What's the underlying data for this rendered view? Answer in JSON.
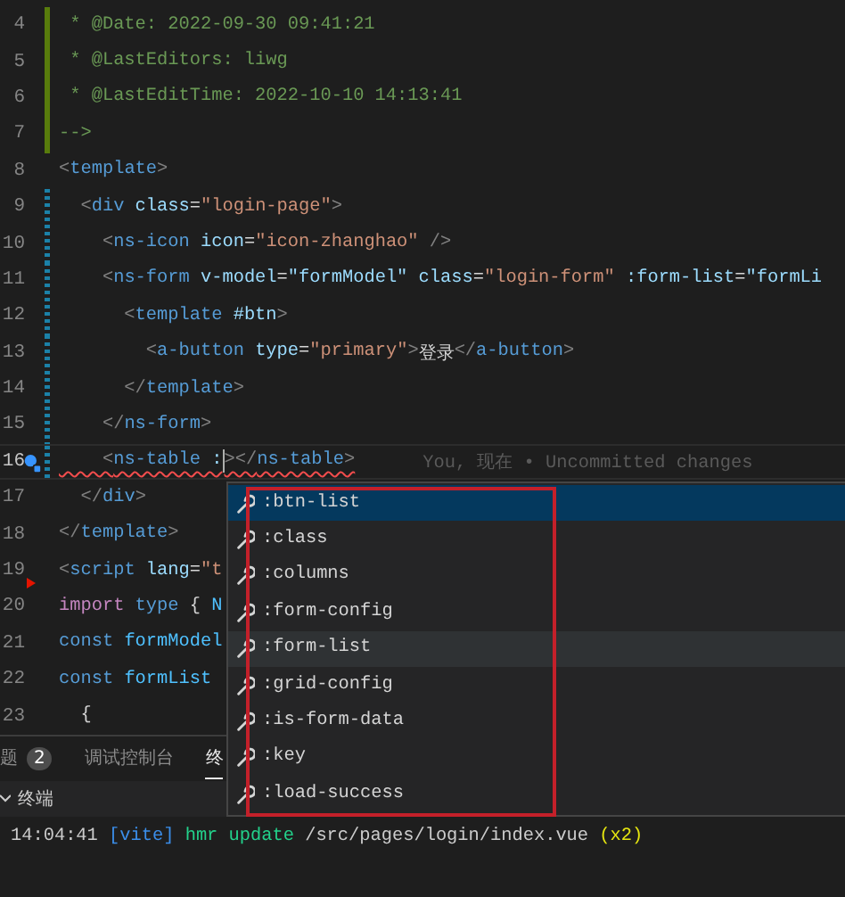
{
  "editor": {
    "lines": [
      {
        "number": "4",
        "added": true,
        "modified": false,
        "current": false,
        "tokens": [
          {
            "kind": "comment",
            "text": " * @Date: 2022-09-30 09:41:21"
          }
        ]
      },
      {
        "number": "5",
        "added": true,
        "modified": false,
        "current": false,
        "tokens": [
          {
            "kind": "comment",
            "text": " * @LastEditors: liwg"
          }
        ]
      },
      {
        "number": "6",
        "added": true,
        "modified": false,
        "current": false,
        "tokens": [
          {
            "kind": "comment",
            "text": " * @LastEditTime: 2022-10-10 14:13:41"
          }
        ]
      },
      {
        "number": "7",
        "added": true,
        "modified": false,
        "current": false,
        "tokens": [
          {
            "kind": "comment",
            "text": "-->"
          }
        ]
      },
      {
        "number": "8",
        "added": false,
        "modified": false,
        "current": false,
        "tokens": [
          {
            "kind": "punct",
            "text": "<"
          },
          {
            "kind": "tag",
            "text": "template"
          },
          {
            "kind": "punct",
            "text": ">"
          }
        ]
      },
      {
        "number": "9",
        "added": false,
        "modified": true,
        "current": false,
        "tokens": [
          {
            "kind": "punct",
            "text": "  <"
          },
          {
            "kind": "tag",
            "text": "div"
          },
          {
            "kind": "attr",
            "text": " class"
          },
          {
            "kind": "text",
            "text": "="
          },
          {
            "kind": "string",
            "text": "\"login-page\""
          },
          {
            "kind": "punct",
            "text": ">"
          }
        ]
      },
      {
        "number": "10",
        "added": false,
        "modified": true,
        "current": false,
        "tokens": [
          {
            "kind": "punct",
            "text": "    <"
          },
          {
            "kind": "tag",
            "text": "ns-icon"
          },
          {
            "kind": "attr",
            "text": " icon"
          },
          {
            "kind": "text",
            "text": "="
          },
          {
            "kind": "string",
            "text": "\"icon-zhanghao\""
          },
          {
            "kind": "punct",
            "text": " />"
          }
        ]
      },
      {
        "number": "11",
        "added": false,
        "modified": true,
        "current": false,
        "tokens": [
          {
            "kind": "punct",
            "text": "    <"
          },
          {
            "kind": "tag",
            "text": "ns-form"
          },
          {
            "kind": "attr",
            "text": " v-model"
          },
          {
            "kind": "text",
            "text": "="
          },
          {
            "kind": "attr",
            "text": "\"formModel\""
          },
          {
            "kind": "attr",
            "text": " class"
          },
          {
            "kind": "text",
            "text": "="
          },
          {
            "kind": "string",
            "text": "\"login-form\""
          },
          {
            "kind": "attr",
            "text": " :form-list"
          },
          {
            "kind": "text",
            "text": "="
          },
          {
            "kind": "attr",
            "text": "\"formLi"
          }
        ]
      },
      {
        "number": "12",
        "added": false,
        "modified": true,
        "current": false,
        "tokens": [
          {
            "kind": "punct",
            "text": "      <"
          },
          {
            "kind": "tag",
            "text": "template"
          },
          {
            "kind": "attr",
            "text": " #btn"
          },
          {
            "kind": "punct",
            "text": ">"
          }
        ]
      },
      {
        "number": "13",
        "added": false,
        "modified": true,
        "current": false,
        "tokens": [
          {
            "kind": "punct",
            "text": "        <"
          },
          {
            "kind": "tag",
            "text": "a-button"
          },
          {
            "kind": "attr",
            "text": " type"
          },
          {
            "kind": "text",
            "text": "="
          },
          {
            "kind": "string",
            "text": "\"primary\""
          },
          {
            "kind": "punct",
            "text": ">"
          },
          {
            "kind": "text",
            "text": "登录"
          },
          {
            "kind": "punct",
            "text": "</"
          },
          {
            "kind": "tag",
            "text": "a-button"
          },
          {
            "kind": "punct",
            "text": ">"
          }
        ]
      },
      {
        "number": "14",
        "added": false,
        "modified": true,
        "current": false,
        "tokens": [
          {
            "kind": "punct",
            "text": "      </"
          },
          {
            "kind": "tag",
            "text": "template"
          },
          {
            "kind": "punct",
            "text": ">"
          }
        ]
      },
      {
        "number": "15",
        "added": false,
        "modified": true,
        "current": false,
        "tokens": [
          {
            "kind": "punct",
            "text": "    </"
          },
          {
            "kind": "tag",
            "text": "ns-form"
          },
          {
            "kind": "punct",
            "text": ">"
          }
        ]
      },
      {
        "number": "16",
        "added": false,
        "modified": true,
        "current": true,
        "error": true,
        "lightbulb": true,
        "blame": "You, 现在 • Uncommitted changes",
        "tokens": [
          {
            "kind": "punct",
            "text": "    <"
          },
          {
            "kind": "tag",
            "text": "ns-table"
          },
          {
            "kind": "attr",
            "text": " :",
            "cursor_after": true
          },
          {
            "kind": "punct",
            "text": "></"
          },
          {
            "kind": "tag",
            "text": "ns-table"
          },
          {
            "kind": "punct",
            "text": ">"
          }
        ]
      },
      {
        "number": "17",
        "added": false,
        "modified": false,
        "current": false,
        "tokens": [
          {
            "kind": "punct",
            "text": "  </"
          },
          {
            "kind": "tag",
            "text": "div"
          },
          {
            "kind": "punct",
            "text": ">"
          }
        ]
      },
      {
        "number": "18",
        "added": false,
        "modified": false,
        "current": false,
        "tokens": [
          {
            "kind": "punct",
            "text": "</"
          },
          {
            "kind": "tag",
            "text": "template"
          },
          {
            "kind": "punct",
            "text": ">"
          }
        ]
      },
      {
        "number": "19",
        "added": false,
        "modified": false,
        "current": false,
        "tokens": [
          {
            "kind": "punct",
            "text": "<"
          },
          {
            "kind": "tag",
            "text": "script"
          },
          {
            "kind": "attr",
            "text": " lang"
          },
          {
            "kind": "text",
            "text": "="
          },
          {
            "kind": "string",
            "text": "\"t"
          }
        ]
      },
      {
        "number": "20",
        "added": false,
        "modified": false,
        "current": false,
        "fold_marker": true,
        "tokens": [
          {
            "kind": "keyword",
            "text": "import"
          },
          {
            "kind": "tag",
            "text": " type"
          },
          {
            "kind": "text",
            "text": " { "
          },
          {
            "kind": "variable",
            "text": "N"
          }
        ]
      },
      {
        "number": "21",
        "added": false,
        "modified": false,
        "current": false,
        "tokens": [
          {
            "kind": "tag",
            "text": "const"
          },
          {
            "kind": "variable",
            "text": " formModel"
          }
        ]
      },
      {
        "number": "22",
        "added": false,
        "modified": false,
        "current": false,
        "tokens": [
          {
            "kind": "tag",
            "text": "const"
          },
          {
            "kind": "variable",
            "text": " formList"
          }
        ]
      },
      {
        "number": "23",
        "added": false,
        "modified": false,
        "current": false,
        "tokens": [
          {
            "kind": "text",
            "text": "  {"
          }
        ]
      }
    ]
  },
  "suggestions": [
    {
      "label": ":btn-list",
      "selected": true,
      "hovered": false
    },
    {
      "label": ":class",
      "selected": false,
      "hovered": false
    },
    {
      "label": ":columns",
      "selected": false,
      "hovered": false
    },
    {
      "label": ":form-config",
      "selected": false,
      "hovered": false
    },
    {
      "label": ":form-list",
      "selected": false,
      "hovered": true
    },
    {
      "label": ":grid-config",
      "selected": false,
      "hovered": false
    },
    {
      "label": ":is-form-data",
      "selected": false,
      "hovered": false
    },
    {
      "label": ":key",
      "selected": false,
      "hovered": false
    },
    {
      "label": ":load-success",
      "selected": false,
      "hovered": false
    }
  ],
  "panel": {
    "tabs": [
      {
        "label": "题",
        "badge": "2",
        "selected": false
      },
      {
        "label": "调试控制台",
        "selected": false
      },
      {
        "label": "终",
        "selected": true
      }
    ],
    "terminal_title": "终端",
    "terminal_lines": [
      [
        {
          "kind": "time",
          "text": "14:04:41 "
        },
        {
          "kind": "tool",
          "text": "[vite]"
        },
        {
          "kind": "action",
          "text": " hmr update"
        },
        {
          "kind": "plain",
          "text": " /src/pages/login/index.vue "
        },
        {
          "kind": "count",
          "text": "(x2)"
        }
      ]
    ]
  }
}
